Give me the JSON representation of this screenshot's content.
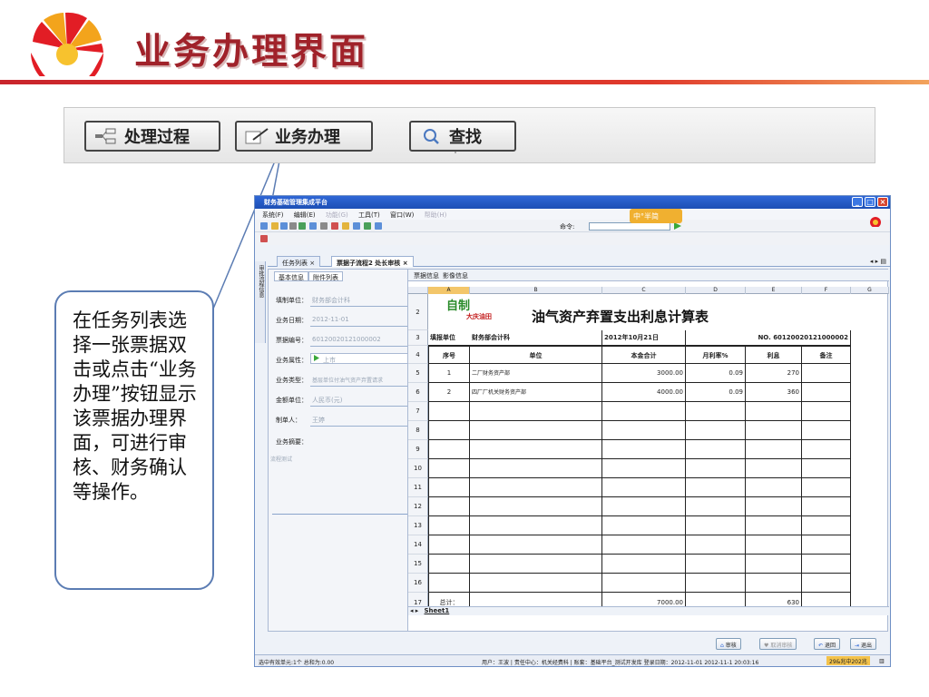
{
  "slide": {
    "title": "业务办理界面"
  },
  "zoom_toolbar": {
    "process_label": "处理过程",
    "handle_label": "业务办理",
    "search_label": "查找"
  },
  "callout": {
    "text": "在任务列表选择一张票据双击或点击“业务办理”按钮显示该票据办理界面，可进行审核、财务确认等操作。"
  },
  "window": {
    "title": "财务基础管理集成平台",
    "menu": [
      "系统(F)",
      "编辑(E)",
      "功能(G)",
      "工具(T)",
      "窗口(W)",
      "帮助(H)"
    ],
    "cmd_label": "命令:",
    "badge": "中°半简",
    "tabs": [
      "任务列表",
      "票据子流程2 处长审核"
    ],
    "vertical_strip": "审批流程信息"
  },
  "form": {
    "subtabs": [
      "基本信息",
      "附件列表"
    ],
    "fields": [
      {
        "label": "填制单位：",
        "value": "财务部会计科"
      },
      {
        "label": "业务日期：",
        "value": "2012-11-01"
      },
      {
        "label": "票据编号：",
        "value": "60120020121000002"
      },
      {
        "label": "业务属性：",
        "value": "上市"
      },
      {
        "label": "业务类型：",
        "value": "基层单位付油气资产弃置请求"
      },
      {
        "label": "金额单位：",
        "value": "人民币(元)"
      },
      {
        "label": "制单人：",
        "value": "王婷"
      },
      {
        "label": "业务摘要：",
        "value": ""
      }
    ],
    "summary_text": "流程测试"
  },
  "sheet": {
    "tabs": [
      "票据信息",
      "影像信息"
    ],
    "columns": [
      "A",
      "B",
      "C",
      "D",
      "E",
      "F",
      "G"
    ],
    "logo_a": "自制",
    "logo_b": "大庆油田",
    "title": "油气资产弃置支出利息计算表",
    "row3": {
      "label": "填报单位",
      "unit": "财务部会计科",
      "date": "2012年10月21日",
      "no": "NO. 60120020121000002"
    },
    "headers": [
      "序号",
      "单位",
      "本金合计",
      "月利率%",
      "利息",
      "备注"
    ],
    "rows": [
      {
        "n": "1",
        "unit": "二厂财务资产部",
        "principal": "3000.00",
        "rate": "0.09",
        "interest": "270"
      },
      {
        "n": "2",
        "unit": "四厂厂机关财务资产部",
        "principal": "4000.00",
        "rate": "0.09",
        "interest": "360"
      }
    ],
    "row_numbers": [
      "2",
      "3",
      "4",
      "5",
      "6",
      "7",
      "8",
      "9",
      "10",
      "11",
      "12",
      "13",
      "14",
      "15",
      "16",
      "17"
    ],
    "total": {
      "label": "总计：",
      "principal": "7000.00",
      "interest": "630"
    },
    "sheet_name": "Sheet1"
  },
  "actions": [
    "审核",
    "取消审核",
    "退回",
    "退出"
  ],
  "status": {
    "left": "选中有效单元:1个  总和为:0.00",
    "user": "用户：王波 | 责任中心：机关经费科 | 账套：基础平台_测试开发库  登录日期：2012-11-01  2012-11-1 20:03:16",
    "mem": "29&兆中202兆"
  },
  "colors": {
    "title_red": "#a0222a",
    "window_blue": "#1d4fb5",
    "callout_border": "#5b7cb3"
  }
}
